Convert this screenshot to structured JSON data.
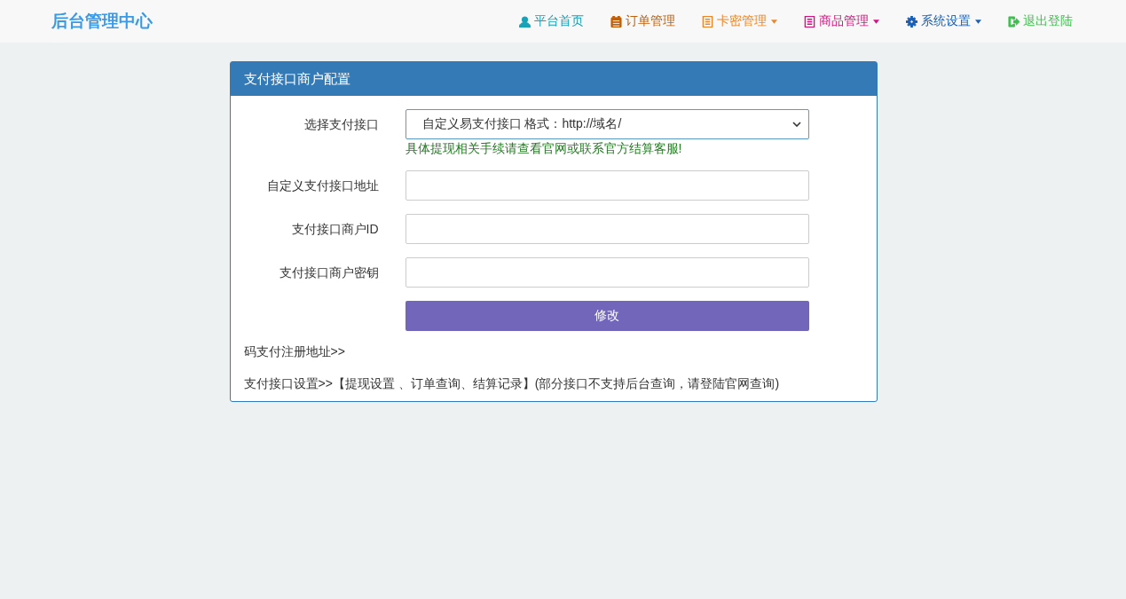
{
  "brand": "后台管理中心",
  "nav": [
    {
      "label": "平台首页",
      "color": "#17a2b8",
      "dropdown": false
    },
    {
      "label": "订单管理",
      "color": "#c0600b",
      "dropdown": false
    },
    {
      "label": "卡密管理",
      "color": "#e8872c",
      "dropdown": true
    },
    {
      "label": "商品管理",
      "color": "#d0157f",
      "dropdown": true
    },
    {
      "label": "系统设置",
      "color": "#1a5fb4",
      "dropdown": true
    },
    {
      "label": "退出登陆",
      "color": "#3cbf4c",
      "dropdown": false
    }
  ],
  "panel": {
    "title": "支付接口商户配置",
    "fields": [
      {
        "kind": "select",
        "label": "选择支付接口",
        "value": "自定义易支付接口 格式：http://域名/",
        "help": "具体提现相关手续请查看官网或联系官方结算客服!"
      },
      {
        "kind": "input",
        "label": "自定义支付接口地址"
      },
      {
        "kind": "input",
        "label": "支付接口商户ID"
      },
      {
        "kind": "input",
        "label": "支付接口商户密钥"
      }
    ],
    "submit": "修改",
    "links": [
      "码支付注册地址>>",
      "支付接口设置>>【提现设置 、订单查询、结算记录】(部分接口不支持后台查询，请登陆官网查询)"
    ]
  }
}
